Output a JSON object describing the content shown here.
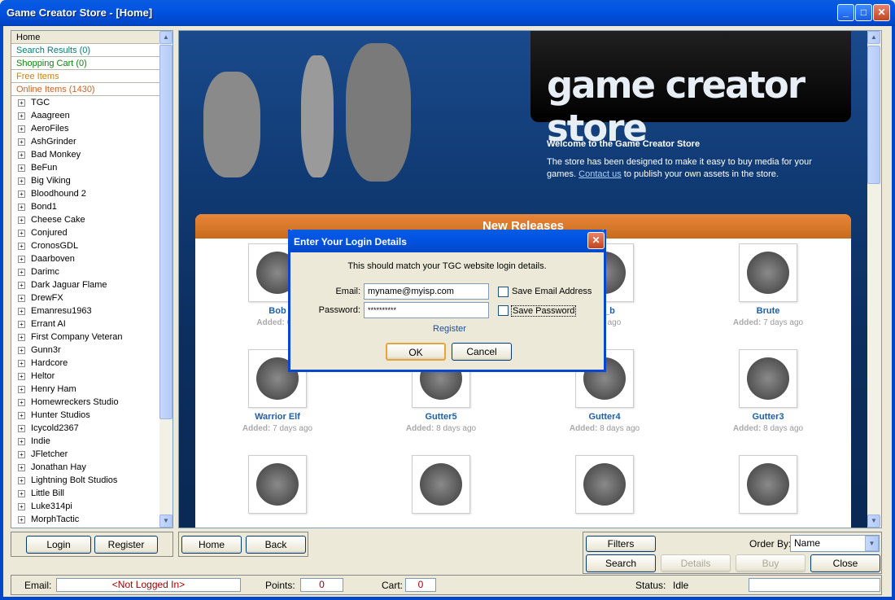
{
  "window": {
    "title": "Game Creator Store - [Home]",
    "minimize": "_",
    "maximize": "□",
    "close": "✕"
  },
  "nav": [
    {
      "label": "Home",
      "color": "#000000"
    },
    {
      "label": "Search Results (0)",
      "color": "#0a7a7a"
    },
    {
      "label": "Shopping Cart (0)",
      "color": "#108010"
    },
    {
      "label": "Free Items",
      "color": "#d08000"
    },
    {
      "label": "Online Items (1430)",
      "color": "#d06020"
    }
  ],
  "tree": [
    "TGC",
    "Aaagreen",
    "AeroFiles",
    "AshGrinder",
    "Bad Monkey",
    "BeFun",
    "Big Viking",
    "Bloodhound 2",
    "Bond1",
    "Cheese Cake",
    "Conjured",
    "CronosGDL",
    "Daarboven",
    "Darimc",
    "Dark Jaguar Flame",
    "DrewFX",
    "Emanresu1963",
    "Errant AI",
    "First Company Veteran",
    "Gunn3r",
    "Hardcore",
    "Heltor",
    "Henry Ham",
    "Homewreckers Studio",
    "Hunter Studios",
    "Icycold2367",
    "Indie",
    "JFletcher",
    "Jonathan Hay",
    "Lightning Bolt Studios",
    "Little Bill",
    "Luke314pi",
    "MorphTactic"
  ],
  "banner": {
    "logo": "game creator store",
    "welcome_title": "Welcome to the Game Creator Store",
    "welcome_text_1": "The store has been designed to make it easy to buy media for your games.",
    "contact_link": "Contact us",
    "welcome_text_2": "to publish your own assets in the store."
  },
  "releases": {
    "heading": "New Releases",
    "items": [
      {
        "name": "Bob",
        "added_label": "Added:",
        "added": "6 d"
      },
      {
        "name": "nk_b",
        "added_label": "",
        "added": "days ago"
      },
      {
        "name": "Brute",
        "added_label": "Added:",
        "added": "7 days ago"
      },
      {
        "name": "Warrior Elf",
        "added_label": "Added:",
        "added": "7 days ago"
      },
      {
        "name": "Gutter5",
        "added_label": "Added:",
        "added": "8 days ago"
      },
      {
        "name": "Gutter4",
        "added_label": "Added:",
        "added": "8 days ago"
      },
      {
        "name": "Gutter3",
        "added_label": "Added:",
        "added": "8 days ago"
      }
    ]
  },
  "buttons": {
    "login": "Login",
    "register": "Register",
    "home": "Home",
    "back": "Back",
    "filters": "Filters",
    "search": "Search",
    "details": "Details",
    "buy": "Buy",
    "close": "Close"
  },
  "order_by": {
    "label": "Order By:",
    "value": "Name"
  },
  "status": {
    "email_label": "Email:",
    "email_value": "<Not Logged In>",
    "points_label": "Points:",
    "points_value": "0",
    "cart_label": "Cart:",
    "cart_value": "0",
    "status_label": "Status:",
    "status_value": "Idle"
  },
  "dialog": {
    "title": "Enter Your Login Details",
    "close": "✕",
    "instructions": "This should match your TGC website login details.",
    "email_label": "Email:",
    "email_value": "myname@myisp.com",
    "password_label": "Password:",
    "password_value": "**********",
    "save_email": "Save Email Address",
    "save_password": "Save Password",
    "register_link": "Register",
    "ok": "OK",
    "cancel": "Cancel"
  }
}
